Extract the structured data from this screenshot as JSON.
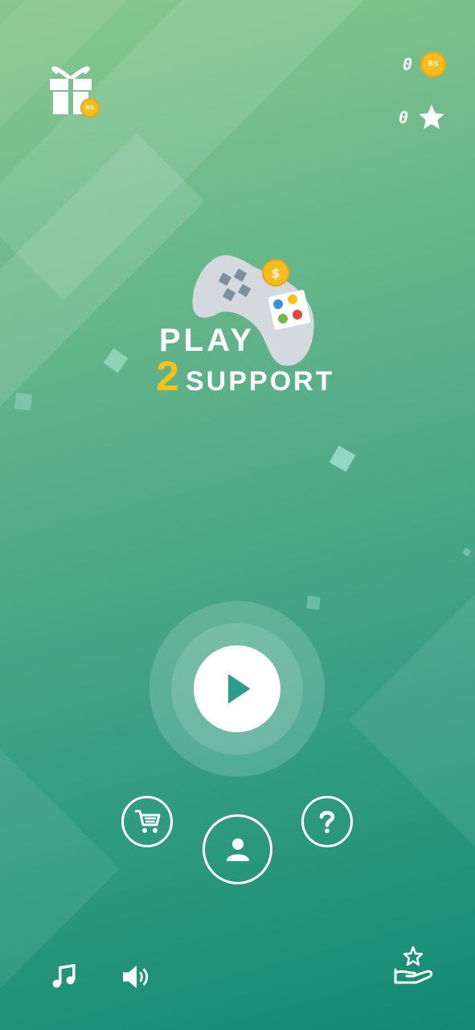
{
  "colors": {
    "coin": "#f5bd1f",
    "accent_two": "#f5c21b",
    "play_triangle": "#2f9e88",
    "controller": "#d3d9df"
  },
  "logo": {
    "line1": "PLAY",
    "number": "2",
    "line2": "SUPPORT",
    "coin_symbol": "$"
  },
  "currency": {
    "coins": "0",
    "coin_symbol": "BS",
    "stars": "0"
  },
  "gift": {
    "icon": "gift-icon",
    "coin_symbol": "BS"
  },
  "menu": {
    "play": "play-icon",
    "shop": "cart-icon",
    "profile": "user-icon",
    "help": "question-icon"
  },
  "bottom_bar": {
    "music": "music-note-icon",
    "sound": "speaker-icon",
    "donate": "hand-star-icon"
  }
}
